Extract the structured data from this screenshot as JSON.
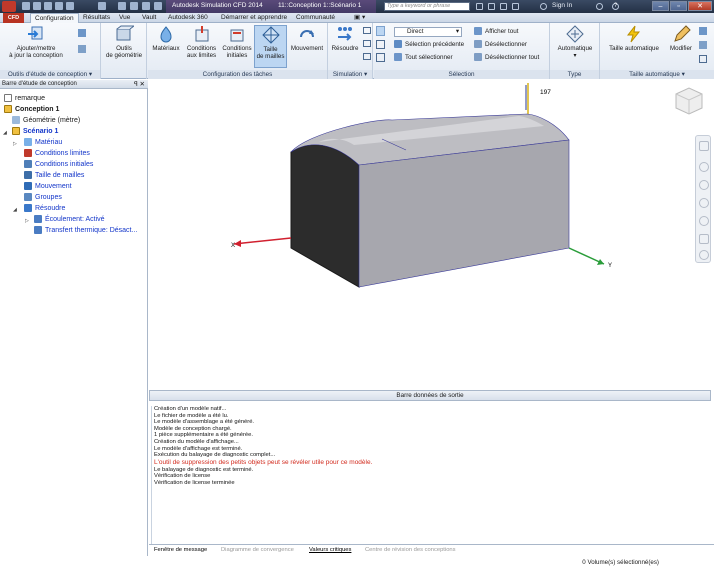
{
  "window": {
    "tabs_title": [
      "Autodesk Simulation CFD 2014",
      "11::Conception 1::Scénario 1"
    ],
    "search_placeholder": "Type a keyword or phrase",
    "signin": "Sign In",
    "help": "?",
    "controls": [
      "–",
      "▫",
      "✕"
    ]
  },
  "menu": {
    "app_button": "CFD",
    "tabs": [
      "Configuration",
      "Résultats",
      "Vue",
      "Vault",
      "Autodesk 360",
      "Démarrer et apprendre",
      "Communauté",
      "▣ ▾"
    ],
    "active_tab": "Configuration"
  },
  "ribbon": {
    "groups": {
      "design_study_tools": "Outils d'étude de conception ▾",
      "task_config": "Configuration des tâches",
      "simulation": "Simulation ▾",
      "selection": "Sélection",
      "type": "Type",
      "auto_size": "Taille automatique ▾"
    },
    "buttons": {
      "add_update": [
        "Ajouter/mettre",
        "à jour la conception"
      ],
      "geometry_tools": [
        "Outils",
        "de géométrie"
      ],
      "materials": [
        "Matériaux"
      ],
      "boundary_conditions": [
        "Conditions",
        "aux limites"
      ],
      "initial_conditions": [
        "Conditions",
        "initiales"
      ],
      "mesh_size": [
        "Taille",
        "de mailles"
      ],
      "motion": [
        "Mouvement"
      ],
      "solve": [
        "Résoudre"
      ],
      "automatic": [
        "Automatique"
      ],
      "auto_size": [
        "Taille automatique"
      ],
      "modify": [
        "Modifier"
      ]
    },
    "selection": {
      "mode": "Direct",
      "previous": "Sélection précédente",
      "select_all": "Tout sélectionner",
      "show_all": "Afficher tout",
      "deselect": "Désélectionner",
      "deselect_all": "Désélectionner tout"
    }
  },
  "left_panel": {
    "title": "Barre d'étude de conception",
    "pin": "ꟼ ✕",
    "tree": {
      "note": "remarque",
      "design": "Conception 1",
      "geometry": "Géométrie (mètre)",
      "scenario": "Scénario 1",
      "material": "Matériau",
      "boundary": "Conditions limites",
      "initial": "Conditions initiales",
      "mesh": "Taille de mailles",
      "motion": "Mouvement",
      "groups": "Groupes",
      "solve": "Résoudre",
      "flow": "Écoulement: Activé",
      "heat": "Transfert thermique: Désact..."
    }
  },
  "viewport": {
    "axis_x": "X",
    "axis_y": "Y",
    "axis_z": "197"
  },
  "output": {
    "title": "Barre données de sortie",
    "lines": [
      "Création d'un modèle natif...",
      "Le fichier de modèle a été lu.",
      "Le modèle d'assemblage a été généré.",
      "Modèle de conception chargé.",
      " 1 pièce supplémentaire a été générée.",
      "Création du modèle d'affichage...",
      "Le modèle d'affichage est terminé.",
      "Exécution du balayage de diagnostic complet...",
      "L'outil de suppression des petits objets peut se révéler utile pour ce modèle.",
      "Le balayage de diagnostic est terminé.",
      "Vérification de license",
      "Vérification de license terminée"
    ],
    "warning_index": 8
  },
  "bottom_tabs": {
    "messages": "Fenêtre de message",
    "convergence": "Diagramme de convergence",
    "critical": "Valeurs critiques",
    "review": "Centre de révision des conceptions"
  },
  "status": {
    "text": "0 Volume(s) sélectionné(es)"
  }
}
